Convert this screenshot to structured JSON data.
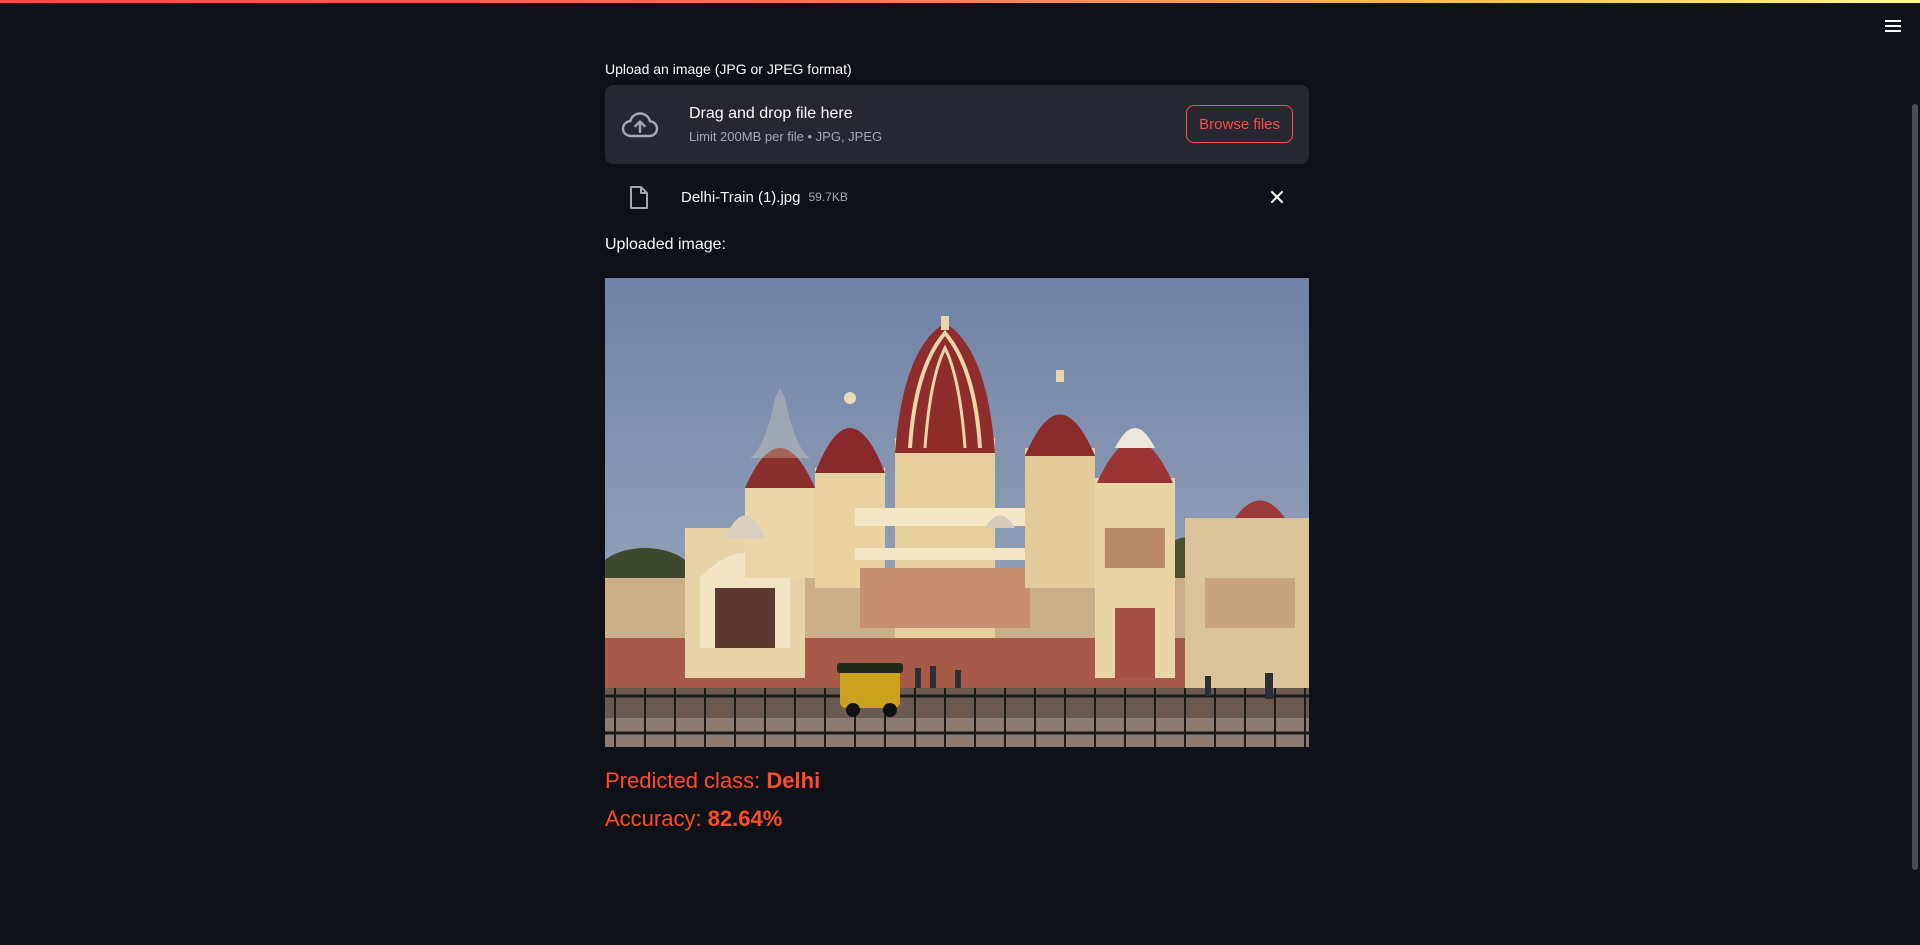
{
  "upload": {
    "label": "Upload an image (JPG or JPEG format)",
    "drop_title": "Drag and drop file here",
    "drop_limit": "Limit 200MB per file • JPG, JPEG",
    "browse_label": "Browse files"
  },
  "file": {
    "name": "Delhi-Train (1).jpg",
    "size": "59.7KB"
  },
  "uploaded_label": "Uploaded image:",
  "result": {
    "class_label": "Predicted class: ",
    "class_value": "Delhi",
    "accuracy_label": "Accuracy: ",
    "accuracy_value": "82.64%"
  },
  "icons": {
    "menu": "hamburger-menu-icon",
    "upload": "cloud-upload-icon",
    "file": "file-icon",
    "close": "close-icon"
  },
  "colors": {
    "background": "#0e1117",
    "panel": "#262730",
    "accent": "#ff4b4b",
    "result": "#ff4b2b"
  }
}
